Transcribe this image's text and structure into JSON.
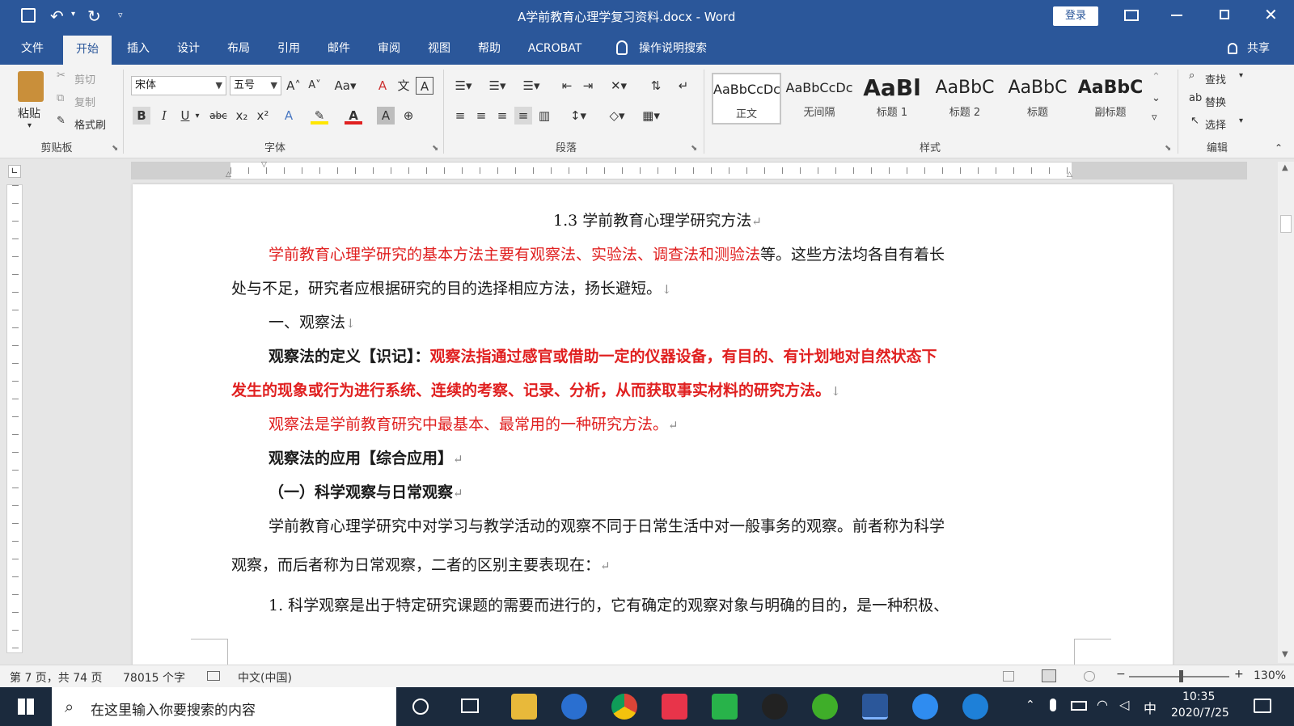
{
  "titlebar": {
    "title": "A学前教育心理学复习资料.docx  -  Word",
    "login": "登录"
  },
  "tabs": [
    "文件",
    "开始",
    "插入",
    "设计",
    "布局",
    "引用",
    "邮件",
    "审阅",
    "视图",
    "帮助",
    "ACROBAT"
  ],
  "tell_me": "操作说明搜索",
  "share": "共享",
  "clipboard": {
    "paste": "粘贴",
    "cut": "剪切",
    "copy": "复制",
    "format_painter": "格式刷",
    "group": "剪贴板"
  },
  "font": {
    "name": "宋体",
    "size": "五号",
    "group": "字体"
  },
  "paragraph": {
    "group": "段落"
  },
  "styles": {
    "items": [
      {
        "preview": "AaBbCcDc",
        "name": "正文"
      },
      {
        "preview": "AaBbCcDc",
        "name": "无间隔"
      },
      {
        "preview": "AaBl",
        "name": "标题 1"
      },
      {
        "preview": "AaBbC",
        "name": "标题 2"
      },
      {
        "preview": "AaBbC",
        "name": "标题"
      },
      {
        "preview": "AaBbC",
        "name": "副标题"
      }
    ],
    "group": "样式"
  },
  "editing": {
    "find": "查找",
    "replace": "替换",
    "select": "选择",
    "group": "编辑"
  },
  "doc": {
    "heading": "1.3 学前教育心理学研究方法",
    "p1_red": "学前教育心理学研究的基本方法主要有观察法、实验法、调查法和测验法",
    "p1_rest": "等。这些方法均各自有着长",
    "p1_line2": "处与不足，研究者应根据研究的目的选择相应方法，扬长避短。",
    "s1": "一、观察法",
    "def_label": "观察法的定义【识记】：",
    "def_red1": "观察法指通过感官或借助一定的仪器设备，有目的、有计划地对自然状态下",
    "def_red2": "发生的现象或行为进行系统、连续的考察、记录、分析，从而获取事实材料的研究方法。",
    "basic": "观察法是学前教育研究中最基本、最常用的一种研究方法。",
    "app": "观察法的应用【综合应用】",
    "sub1": "（一）科学观察与日常观察",
    "para2_l1": "学前教育心理学研究中对学习与教学活动的观察不同于日常生活中对一般事务的观察。前者称为科学",
    "para2_l2": "观察，而后者称为日常观察，二者的区别主要表现在：",
    "item1": "1. 科学观察是出于特定研究课题的需要而进行的，它有确定的观察对象与明确的目的，是一种积极、"
  },
  "status": {
    "page": "第 7 页，共 74 页",
    "words": "78015 个字",
    "lang": "中文(中国)",
    "zoom": "130%"
  },
  "taskbar": {
    "search": "在这里输入你要搜索的内容",
    "time": "10:35",
    "date": "2020/7/25",
    "ime": "中"
  }
}
